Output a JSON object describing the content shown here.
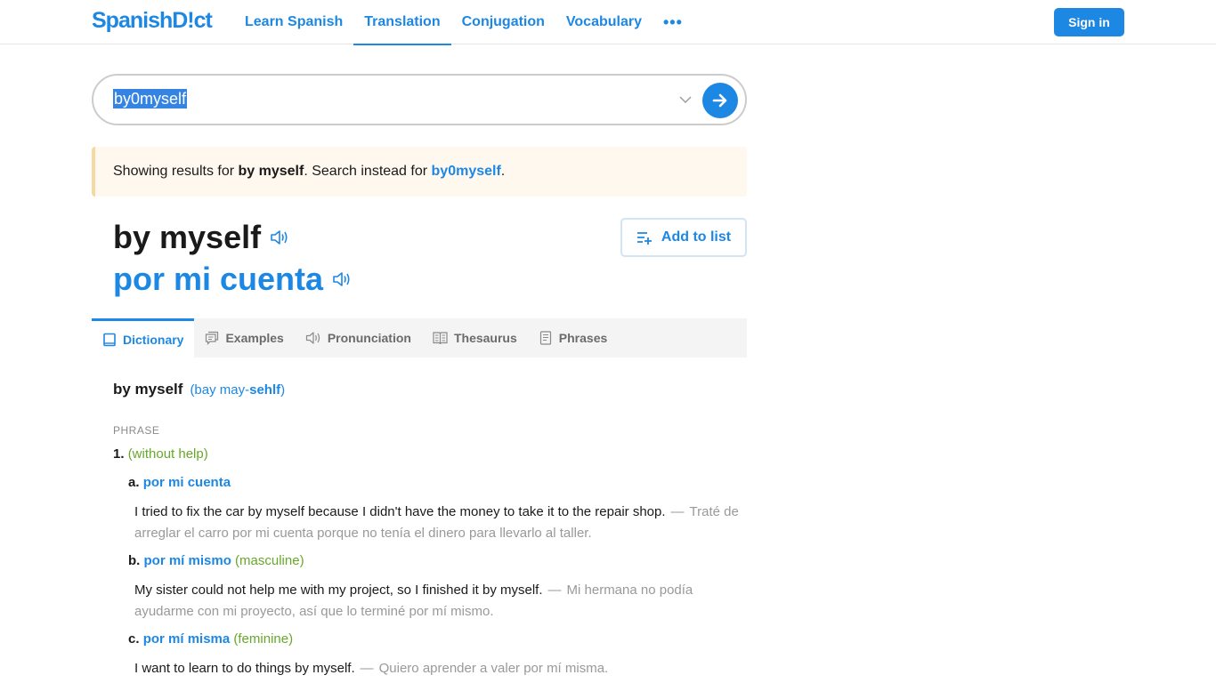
{
  "nav": {
    "logo": "SpanishD!ct",
    "links": [
      {
        "label": "Learn Spanish",
        "active": false
      },
      {
        "label": "Translation",
        "active": true
      },
      {
        "label": "Conjugation",
        "active": false
      },
      {
        "label": "Vocabulary",
        "active": false
      }
    ],
    "more_label": "•••",
    "signin_label": "Sign in"
  },
  "search": {
    "value": "by0myself"
  },
  "notice": {
    "prefix": "Showing results for ",
    "corrected": "by myself",
    "middle": ". Search instead for ",
    "original": "by0myself",
    "suffix": "."
  },
  "headword": {
    "english": "by myself",
    "spanish": "por mi cuenta",
    "add_to_list_label": "Add to list"
  },
  "tabs": [
    {
      "label": "Dictionary",
      "icon": "book-icon",
      "active": true
    },
    {
      "label": "Examples",
      "icon": "speech-bubble-icon",
      "active": false
    },
    {
      "label": "Pronunciation",
      "icon": "speaker-icon",
      "active": false
    },
    {
      "label": "Thesaurus",
      "icon": "open-book-icon",
      "active": false
    },
    {
      "label": "Phrases",
      "icon": "document-icon",
      "active": false
    }
  ],
  "entry": {
    "word": "by myself",
    "pron_open": "(bay may-",
    "pron_stress": "sehlf",
    "pron_close": ")",
    "part_of_speech": "PHRASE",
    "sense": {
      "number": "1.",
      "context": "(without help)",
      "translations": [
        {
          "letter": "a.",
          "text": "por mi cuenta",
          "note": "",
          "example_en": "I tried to fix the car by myself because I didn't have the money to take it to the repair shop.",
          "example_es": "Traté de arreglar el carro por mi cuenta porque no tenía el dinero para llevarlo al taller."
        },
        {
          "letter": "b.",
          "text": "por mí mismo",
          "note": "(masculine)",
          "example_en": "My sister could not help me with my project, so I finished it by myself.",
          "example_es": "Mi hermana no podía ayudarme con mi proyecto, así que lo terminé por mí mismo."
        },
        {
          "letter": "c.",
          "text": "por mí misma",
          "note": "(feminine)",
          "example_en": "I want to learn to do things by myself.",
          "example_es": "Quiero aprender a valer por mí misma."
        }
      ]
    },
    "dash": "—"
  }
}
